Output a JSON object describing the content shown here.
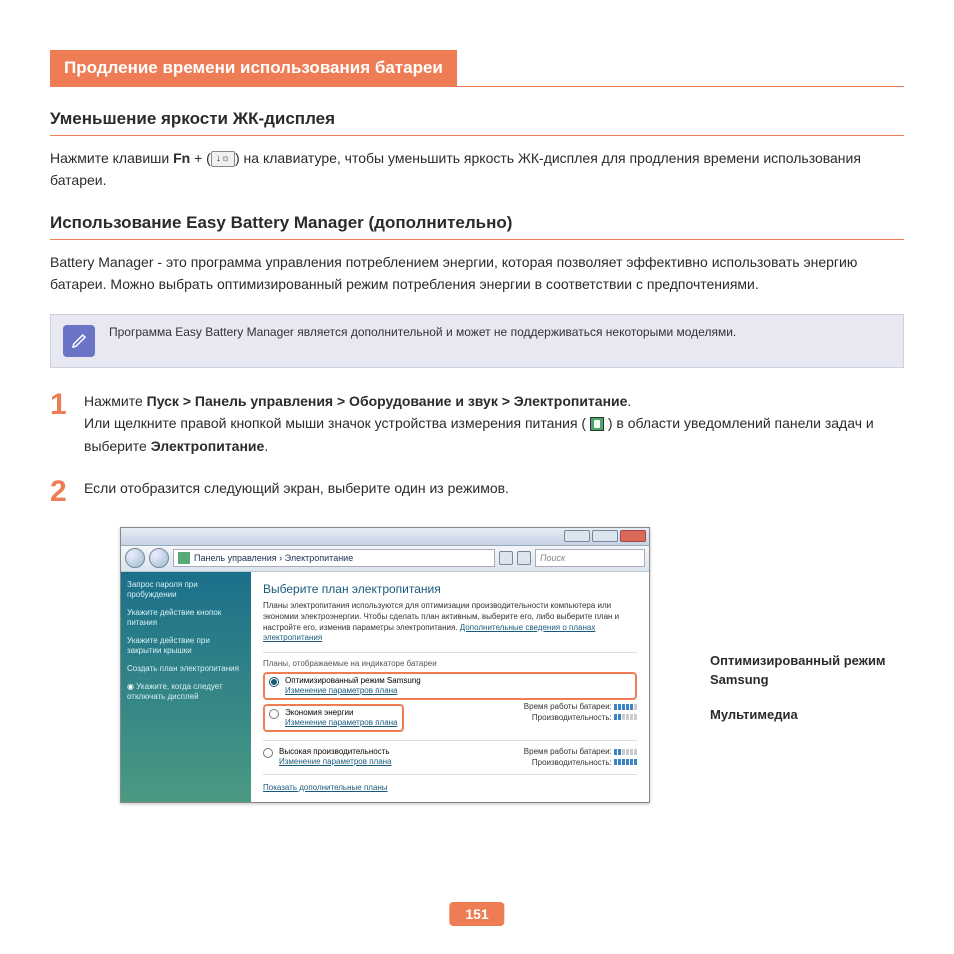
{
  "title": "Продление времени использования батареи",
  "sub1": "Уменьшение яркости ЖК-дисплея",
  "para1_pre": "Нажмите клавиши ",
  "para1_fn": "Fn",
  "para1_plus": " + (",
  "para1_keyicon": "↓☼",
  "para1_post": ") на клавиатуре, чтобы уменьшить яркость ЖК-дисплея для продления времени использования батареи.",
  "sub2": "Использование Easy Battery Manager (дополнительно)",
  "para2": "Battery Manager - это программа управления потреблением энергии, которая позволяет эффективно использовать энергию батареи. Можно выбрать оптимизированный режим потребления энергии в соответствии с предпочтениями.",
  "note": "Программа Easy Battery Manager является дополнительной и может не поддерживаться некоторыми моделями.",
  "step1_num": "1",
  "step1_line1_pre": "Нажмите ",
  "step1_line1_bold": "Пуск > Панель управления > Оборудование и звук > Электропитание",
  "step1_line1_post": ".",
  "step1_line2_pre": "Или щелкните правой кнопкой мыши значок устройства измерения питания ( ",
  "step1_line2_post": " ) в области уведомлений панели задач и выберите ",
  "step1_line2_bold": "Электропитание",
  "step1_line2_end": ".",
  "step2_num": "2",
  "step2_text": "Если отобразится следующий экран, выберите один из режимов.",
  "win": {
    "breadcrumb": "Панель управления  ›  Электропитание",
    "search_placeholder": "Поиск",
    "sidebar": [
      "Запрос пароля при пробуждении",
      "Укажите действие кнопок питания",
      "Укажите действие при закрытии крышки",
      "Создать план электропитания",
      "Укажите, когда следует отключать дисплей"
    ],
    "main_title": "Выберите план электропитания",
    "main_desc": "Планы электропитания используются для оптимизации производительности компьютера или экономии электроэнергии. Чтобы сделать план активным, выберите его, либо выберите план и настройте его, изменив параметры электропитания. ",
    "main_desc_link": "Дополнительные сведения о планах электропитания",
    "section_label": "Планы, отображаемые на индикаторе батареи",
    "plan1_name": "Оптимизированный режим Samsung",
    "plan2_name": "Экономия энергии",
    "plan3_name": "Высокая производительность",
    "change_link": "Изменение параметров плана",
    "meter_time": "Время работы батареи:",
    "meter_perf": "Производительность:",
    "show_more": "Показать дополнительные планы"
  },
  "callout1": "Оптимизированный режим Samsung",
  "callout2": "Мультимедиа",
  "page_number": "151"
}
